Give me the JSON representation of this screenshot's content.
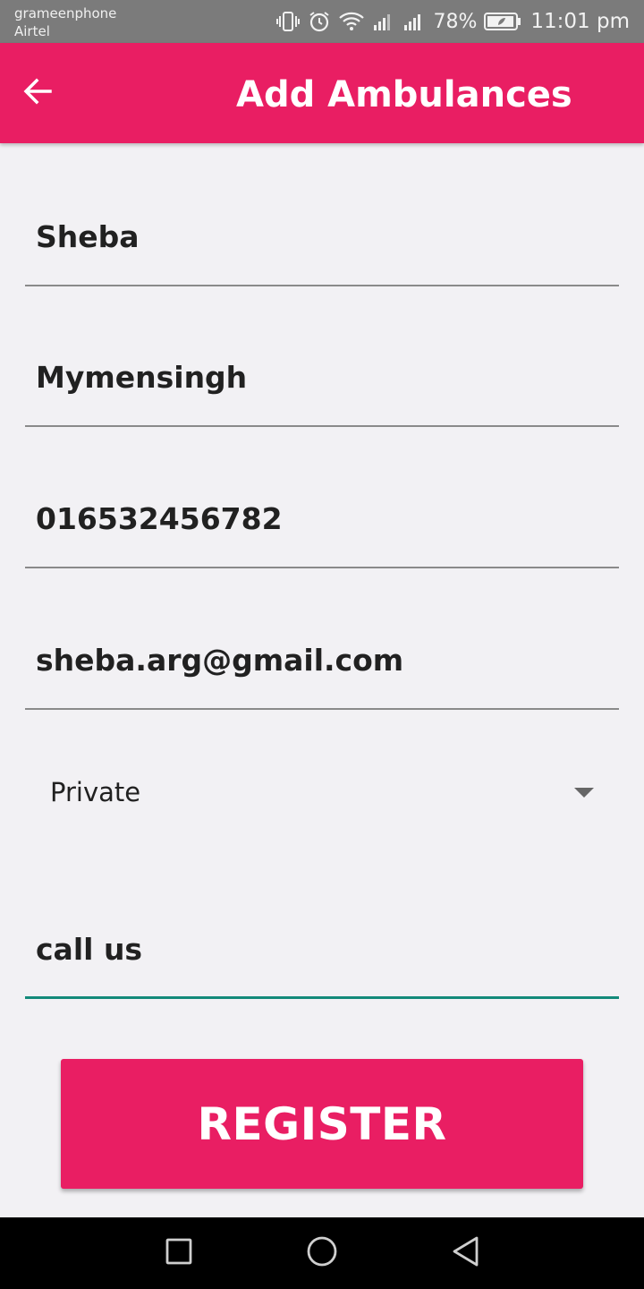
{
  "status_bar": {
    "carrier_1": "grameenphone",
    "carrier_2": "Airtel",
    "battery_percent": "78%",
    "time": "11:01 pm"
  },
  "app_bar": {
    "title": "Add Ambulances",
    "back_icon": "arrow-back-icon"
  },
  "form": {
    "name": "Sheba",
    "location": "Mymensingh",
    "phone": "016532456782",
    "email": "sheba.arg@gmail.com",
    "type_selected": "Private",
    "note": "call us"
  },
  "register_button": {
    "label": "REGISTER"
  },
  "colors": {
    "primary": "#e91e63",
    "focus_line": "#138a7a",
    "background": "#f2f1f4"
  }
}
